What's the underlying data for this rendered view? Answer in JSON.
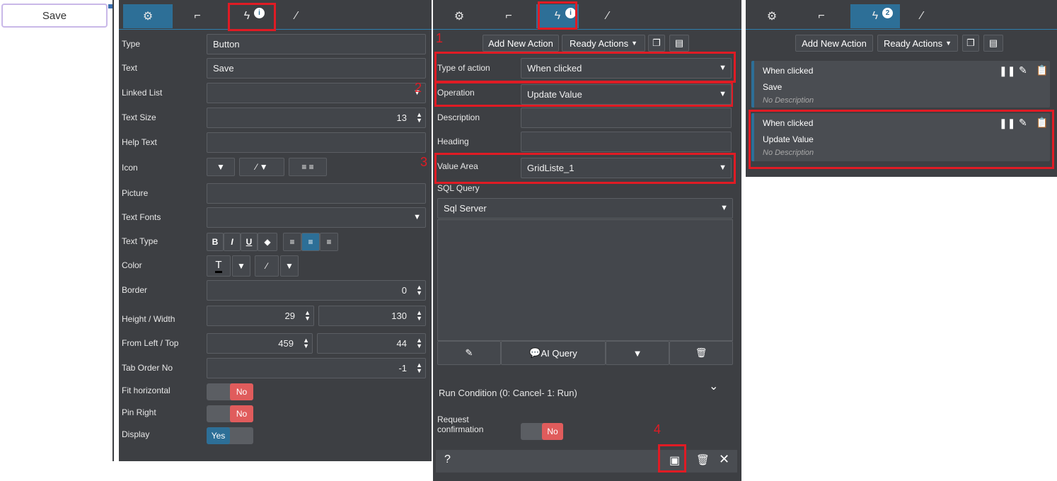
{
  "preview": {
    "save_button_label": "Save"
  },
  "props_panel": {
    "tabs": [
      {
        "name": "settings",
        "icon": "gear-icon"
      },
      {
        "name": "layout",
        "icon": "layout-icon"
      },
      {
        "name": "actions",
        "icon": "lightning-icon",
        "badge": "1"
      },
      {
        "name": "style",
        "icon": "brush-icon"
      }
    ],
    "rows": {
      "type": {
        "label": "Type",
        "value": "Button"
      },
      "text": {
        "label": "Text",
        "value": "Save"
      },
      "linked_list": {
        "label": "Linked List",
        "value": ""
      },
      "text_size": {
        "label": "Text Size",
        "value": "13"
      },
      "help_text": {
        "label": "Help Text",
        "value": ""
      },
      "icon": {
        "label": "Icon"
      },
      "picture": {
        "label": "Picture",
        "value": ""
      },
      "text_fonts": {
        "label": "Text Fonts",
        "value": ""
      },
      "text_type": {
        "label": "Text Type"
      },
      "color": {
        "label": "Color"
      },
      "border": {
        "label": "Border",
        "value": "0"
      },
      "height_width": {
        "label": "Height / Width",
        "height": "29",
        "width": "130"
      },
      "from_left_top": {
        "label": "From Left / Top",
        "left": "459",
        "top": "44"
      },
      "tab_order": {
        "label": "Tab Order No",
        "value": "-1"
      },
      "fit_horizontal": {
        "label": "Fit horizontal",
        "value": "No"
      },
      "pin_right": {
        "label": "Pin Right",
        "value": "No"
      },
      "display": {
        "label": "Display",
        "value": "Yes"
      }
    }
  },
  "actions_panel": {
    "add_new_action": "Add New Action",
    "ready_actions": "Ready Actions",
    "type_of_action": {
      "label": "Type of action",
      "value": "When clicked"
    },
    "operation": {
      "label": "Operation",
      "value": "Update Value"
    },
    "description": {
      "label": "Description",
      "value": ""
    },
    "heading": {
      "label": "Heading",
      "value": ""
    },
    "value_area": {
      "label": "Value Area",
      "value": "GridListe_1"
    },
    "sql_query": {
      "label": "SQL Query",
      "server": "Sql Server"
    },
    "ai_query": "AI Query",
    "run_condition": "Run Condition (0: Cancel- 1: Run)",
    "request_confirmation": {
      "label_line1": "Request",
      "label_line2": "confirmation",
      "value": "No"
    },
    "help": "?",
    "markers": [
      "1",
      "2",
      "3",
      "4"
    ]
  },
  "list_panel": {
    "add_new_action": "Add New Action",
    "ready_actions": "Ready Actions",
    "badge": "2",
    "cards": [
      {
        "event": "When clicked",
        "title": "Save",
        "description": "No Description"
      },
      {
        "event": "When clicked",
        "title": "Update Value",
        "description": "No Description"
      }
    ]
  },
  "colors": {
    "panel_bg": "#3d3f43",
    "accent": "#2d6f97",
    "highlight": "#e01b24",
    "toggle_no": "#e05c5c"
  }
}
